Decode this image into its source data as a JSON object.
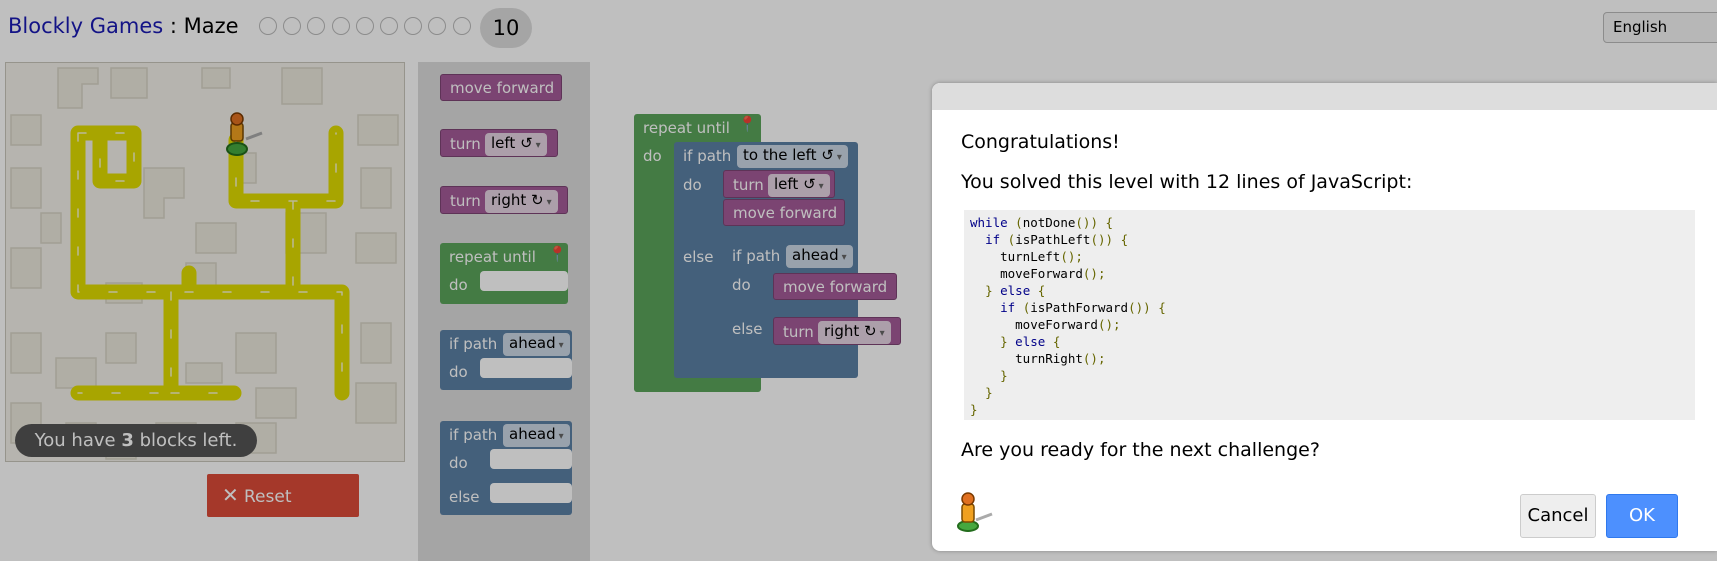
{
  "header": {
    "app_link": "Blockly Games",
    "separator": " : ",
    "game": "Maze",
    "level_number": "10",
    "level_count": 9,
    "language": "English"
  },
  "maze": {
    "blocks_left_prefix": "You have ",
    "blocks_left_count": "3",
    "blocks_left_suffix": " blocks left.",
    "reset_label": "Reset",
    "path_color": "#e0dc00",
    "reset_color": "#dd4b39"
  },
  "toolbox": {
    "move_forward": "move forward",
    "turn": "turn",
    "left": "left",
    "right": "right",
    "repeat_until": "repeat until",
    "do": "do",
    "if_path": "if path",
    "ahead": "ahead",
    "else": "else"
  },
  "workspace": {
    "repeat_until": "repeat until",
    "do": "do",
    "if_path": "if path",
    "to_the_left": "to the left",
    "turn": "turn",
    "left": "left",
    "move_forward": "move forward",
    "else": "else",
    "ahead": "ahead",
    "right": "right",
    "turn_icon": "↻",
    "dropdown_icon": "▾"
  },
  "dialog": {
    "congrats": "Congratulations!",
    "solved": "You solved this level with 12 lines of JavaScript:",
    "code_lines": [
      "while (notDone()) {",
      "  if (isPathLeft()) {",
      "    turnLeft();",
      "    moveForward();",
      "  } else {",
      "    if (isPathForward()) {",
      "      moveForward();",
      "    } else {",
      "      turnRight();",
      "    }",
      "  }",
      "}"
    ],
    "ready": "Are you ready for the next challenge?",
    "cancel": "Cancel",
    "ok": "OK"
  }
}
